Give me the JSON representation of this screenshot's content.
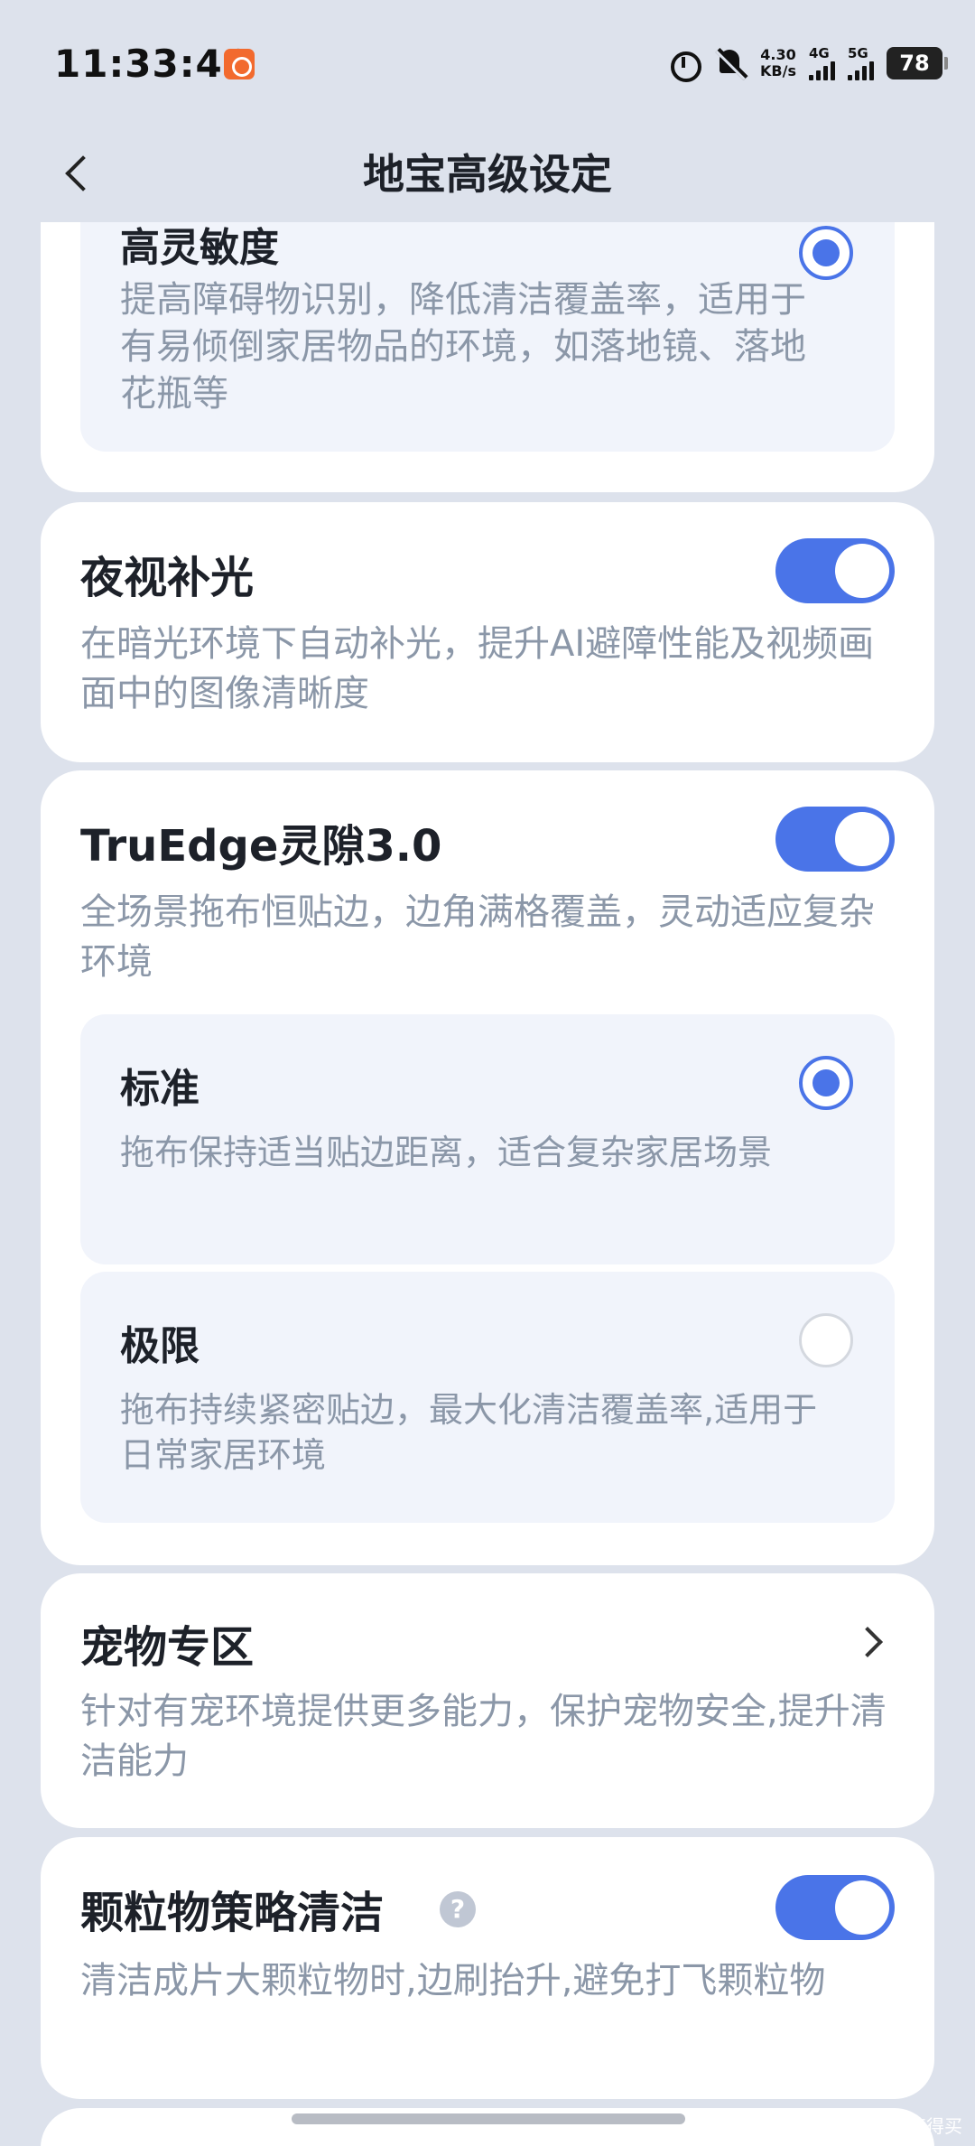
{
  "status_bar": {
    "time": "11:33:46",
    "net_speed_value": "4.30",
    "net_speed_unit": "KB/s",
    "sim1_label": "4G",
    "sim2_label": "5G",
    "battery": "78"
  },
  "header": {
    "title": "地宝高级设定"
  },
  "sensitivity_card": {
    "option_title": "高灵敏度",
    "option_desc": "提高障碍物识别，降低清洁覆盖率，适用于有易倾倒家居物品的环境，如落地镜、落地花瓶等",
    "selected": true
  },
  "night_vision": {
    "title": "夜视补光",
    "desc": "在暗光环境下自动补光，提升AI避障性能及视频画面中的图像清晰度",
    "enabled": true
  },
  "truedge": {
    "title": "TruEdge灵隙3.0",
    "desc": "全场景拖布恒贴边，边角满格覆盖，灵动适应复杂环境",
    "enabled": true,
    "options": [
      {
        "title": "标准",
        "desc": "拖布保持适当贴边距离，适合复杂家居场景",
        "selected": true
      },
      {
        "title": "极限",
        "desc": "拖布持续紧密贴边，最大化清洁覆盖率,适用于日常家居环境",
        "selected": false
      }
    ]
  },
  "pet_zone": {
    "title": "宠物专区",
    "desc": "针对有宠环境提供更多能力，保护宠物安全,提升清洁能力"
  },
  "particle": {
    "title": "颗粒物策略清洁",
    "help": "?",
    "desc": "清洁成片大颗粒物时,边刷抬升,避免打飞颗粒物",
    "enabled": true
  },
  "watermark": "值 什么值得买",
  "colors": {
    "accent": "#4a74e8",
    "background": "#dde2ec",
    "card": "#ffffff",
    "option_bg": "#f1f4fb",
    "secondary_text": "#8b97a8"
  }
}
